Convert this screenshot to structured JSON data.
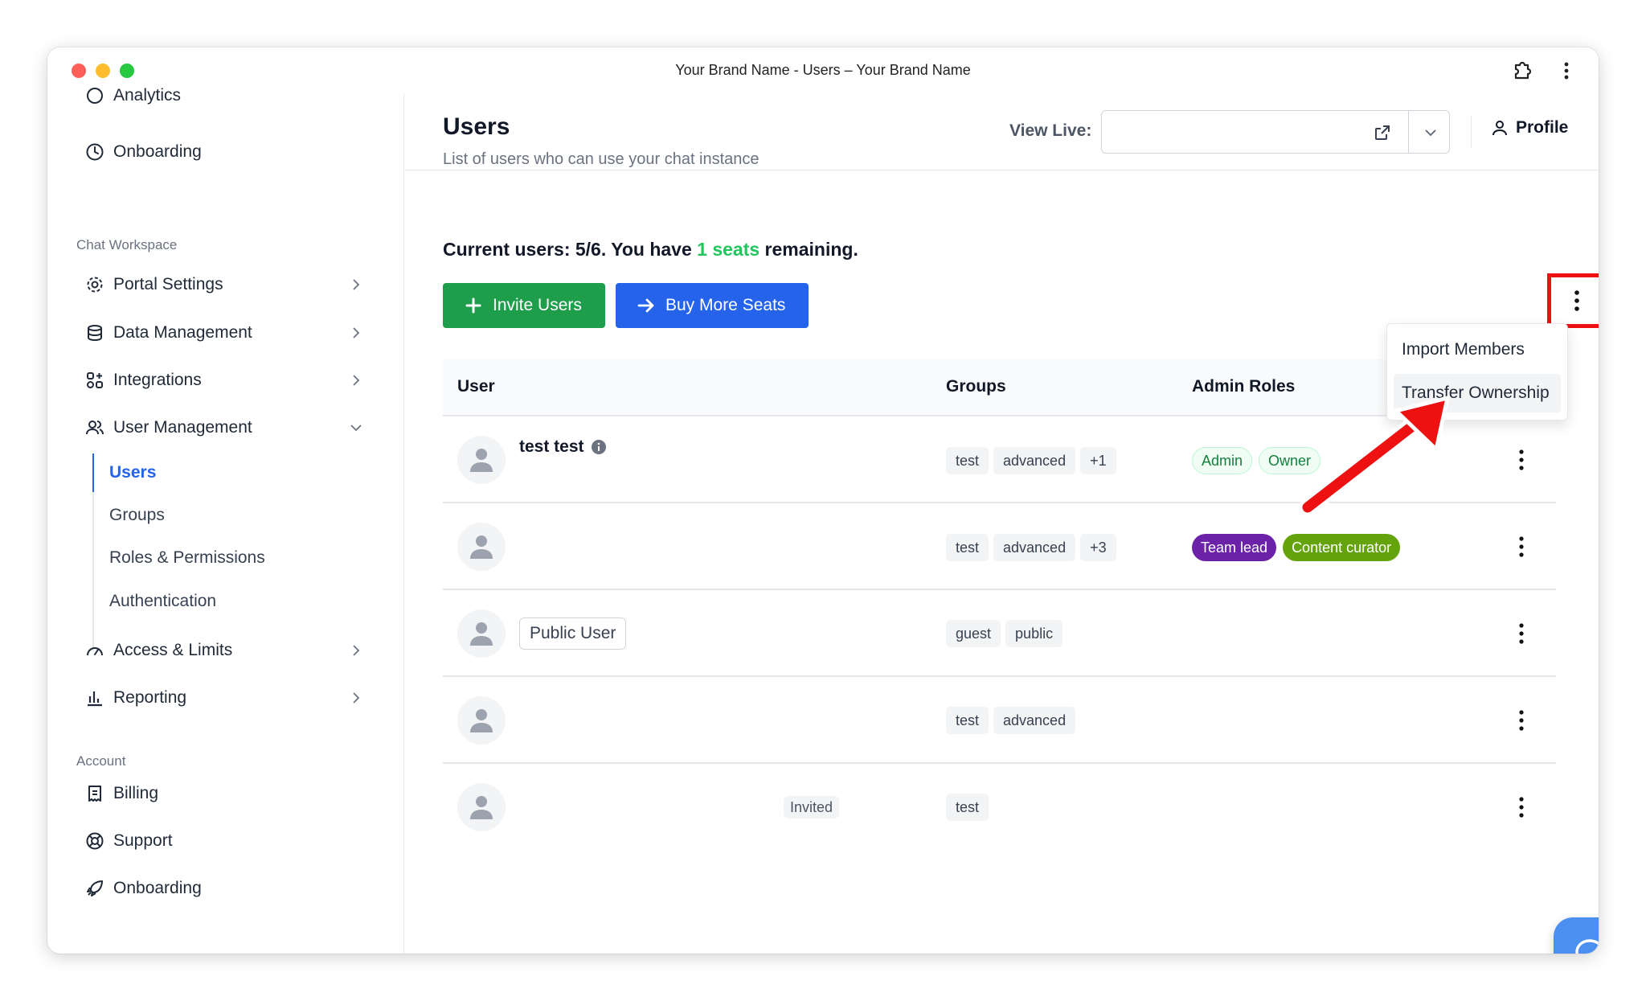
{
  "window": {
    "title": "Your Brand Name - Users – Your Brand Name"
  },
  "sidebar": {
    "top_items": [
      {
        "label": "Analytics"
      },
      {
        "label": "Onboarding"
      }
    ],
    "chat_workspace_heading": "Chat Workspace",
    "workspace_items": [
      {
        "label": "Portal Settings"
      },
      {
        "label": "Data Management"
      },
      {
        "label": "Integrations"
      },
      {
        "label": "User Management"
      }
    ],
    "user_management_sub": [
      {
        "label": "Users"
      },
      {
        "label": "Groups"
      },
      {
        "label": "Roles & Permissions"
      },
      {
        "label": "Authentication"
      }
    ],
    "more_items": [
      {
        "label": "Access & Limits"
      },
      {
        "label": "Reporting"
      }
    ],
    "account_heading": "Account",
    "account_items": [
      {
        "label": "Billing"
      },
      {
        "label": "Support"
      },
      {
        "label": "Onboarding"
      }
    ]
  },
  "header": {
    "title": "Users",
    "subtitle": "List of users who can use your chat instance",
    "view_live_label": "View Live:",
    "view_live_value": "",
    "profile_label": "Profile"
  },
  "seats": {
    "prefix": "Current users: 5/6. You have ",
    "highlight": "1 seats",
    "suffix": " remaining."
  },
  "actions": {
    "invite_label": "Invite Users",
    "buy_label": "Buy More Seats"
  },
  "dropdown": {
    "items": [
      {
        "label": "Import Members"
      },
      {
        "label": "Transfer Ownership"
      }
    ]
  },
  "table": {
    "columns": [
      "User",
      "Groups",
      "Admin Roles"
    ],
    "rows": [
      {
        "name": "test test",
        "groups": [
          "test",
          "advanced",
          "+1"
        ],
        "roles": [
          "Admin",
          "Owner"
        ]
      },
      {
        "name": "",
        "groups": [
          "test",
          "advanced",
          "+3"
        ],
        "roles": [
          "Team lead",
          "Content curator"
        ]
      },
      {
        "name": "Public User",
        "groups": [
          "guest",
          "public"
        ],
        "roles": []
      },
      {
        "name": "",
        "groups": [
          "test",
          "advanced"
        ],
        "roles": []
      },
      {
        "name": "",
        "status": "Invited",
        "groups": [
          "test"
        ],
        "roles": []
      }
    ]
  },
  "colors": {
    "accent_blue": "#2563eb",
    "invite_green": "#1e9e4a",
    "seats_green": "#22c55e",
    "highlight_red": "#ee1111"
  }
}
